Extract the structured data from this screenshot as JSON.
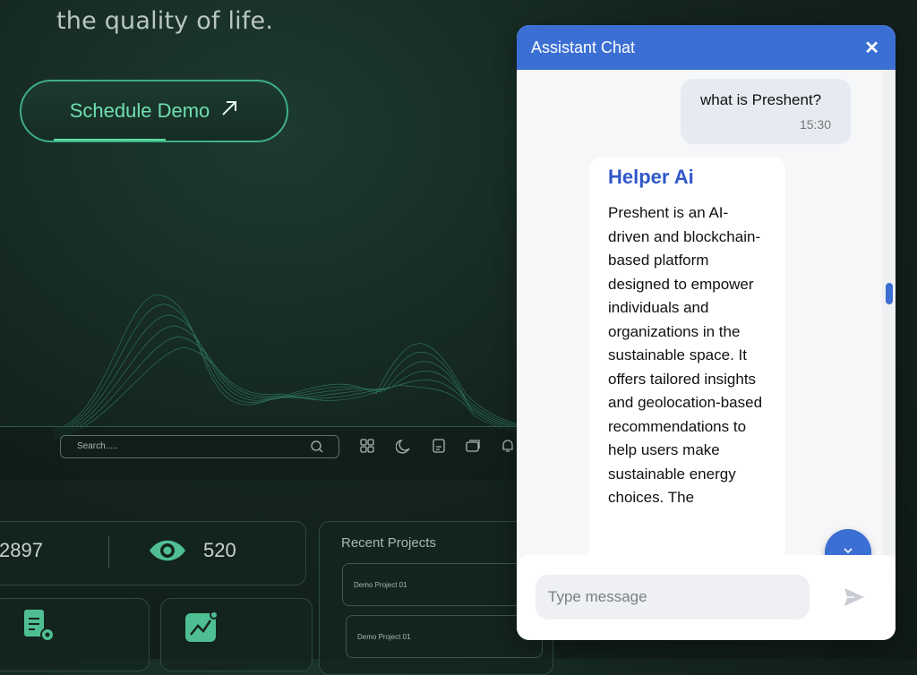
{
  "hero": {
    "tagline": "the quality of life.",
    "cta_label": "Schedule Demo",
    "cta_icon": "arrow-up-right-icon"
  },
  "dashboard": {
    "search_placeholder": "Search.....",
    "toolbar_icons": [
      "grid-icon",
      "moon-icon",
      "document-icon",
      "cards-icon",
      "bell-icon"
    ],
    "stat_value_1": "2897",
    "stat_value_2": "520",
    "recent_title": "Recent Projects",
    "projects": [
      "Demo Project 01",
      "Demo Project 01"
    ]
  },
  "chat": {
    "title": "Assistant Chat",
    "close_symbol": "✕",
    "user_message": "what is Preshent?",
    "user_time": "15:30",
    "bot_name": "Helper Ai",
    "bot_message": "Preshent is an AI-driven and blockchain-based platform designed to empower individuals and organizations in the sustainable space. It offers tailored insights and geolocation-based recommendations to help users make sustainable energy choices. The",
    "input_placeholder": "Type message",
    "accent_color": "#3b6fd4"
  }
}
